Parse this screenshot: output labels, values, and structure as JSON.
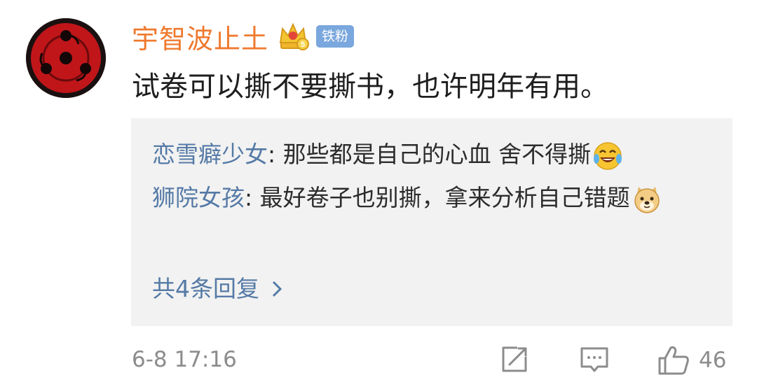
{
  "comment": {
    "username": "宇智波止土",
    "fan_badge": "铁粉",
    "text": "试卷可以撕不要撕书，也许明年有用。",
    "time": "6-8 17:16",
    "like_count": "46",
    "icons": {
      "vip": "crown-badge-icon",
      "share": "share-icon",
      "reply": "comment-icon",
      "like": "thumbs-up-icon"
    }
  },
  "replies": {
    "items": [
      {
        "author": "恋雪癖少女",
        "sep": ": ",
        "text": "那些都是自己的心血 舍不得撕",
        "emoji": "laugh-cry-emoji-icon"
      },
      {
        "author": "狮院女孩",
        "sep": ": ",
        "text": "最好卷子也别撕，拿来分析自己错题",
        "emoji": "doge-emoji-icon"
      }
    ],
    "more_label": "共4条回复"
  },
  "colors": {
    "username": "#ef7a2f",
    "link_blue": "#557aa6",
    "badge_blue": "#7aa7dd",
    "reply_bg": "#f2f2f2",
    "meta_gray": "#8c8c8c"
  }
}
